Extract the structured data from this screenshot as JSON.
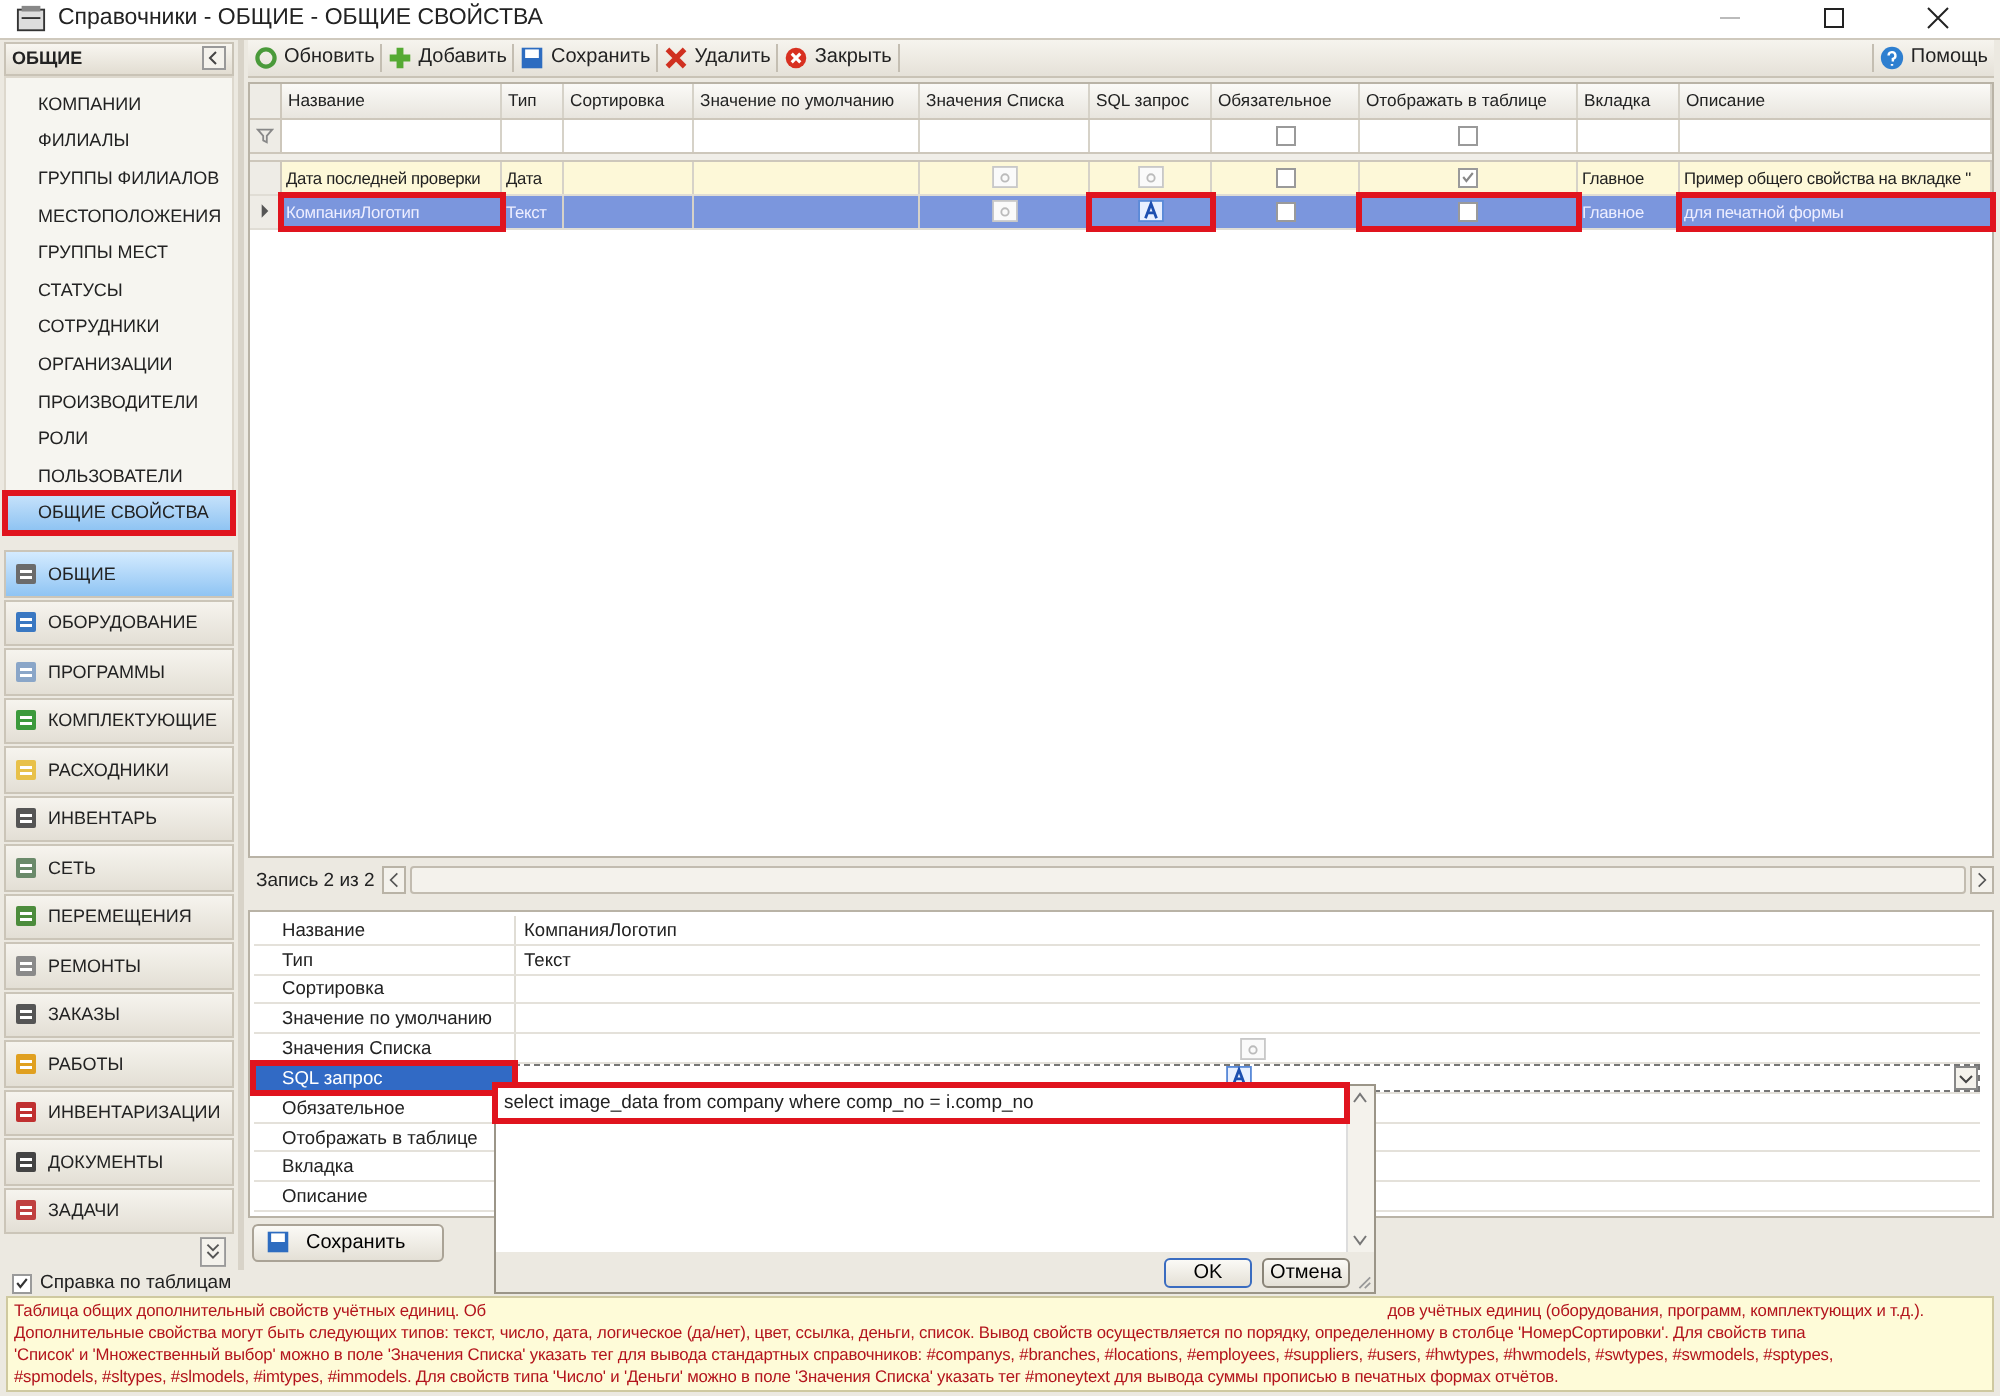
{
  "window": {
    "title": "Справочники - ОБЩИЕ - ОБЩИЕ СВОЙСТВА"
  },
  "sidebar": {
    "header": "ОБЩИЕ",
    "items": [
      {
        "label": "КОМПАНИИ",
        "selected": false,
        "highlighted": false
      },
      {
        "label": "ФИЛИАЛЫ",
        "selected": false,
        "highlighted": false
      },
      {
        "label": "ГРУППЫ ФИЛИАЛОВ",
        "selected": false,
        "highlighted": false
      },
      {
        "label": "МЕСТОПОЛОЖЕНИЯ",
        "selected": false,
        "highlighted": false
      },
      {
        "label": "ГРУППЫ МЕСТ",
        "selected": false,
        "highlighted": false
      },
      {
        "label": "СТАТУСЫ",
        "selected": false,
        "highlighted": false
      },
      {
        "label": "СОТРУДНИКИ",
        "selected": false,
        "highlighted": false
      },
      {
        "label": "ОРГАНИЗАЦИИ",
        "selected": false,
        "highlighted": false
      },
      {
        "label": "ПРОИЗВОДИТЕЛИ",
        "selected": false,
        "highlighted": false
      },
      {
        "label": "РОЛИ",
        "selected": false,
        "highlighted": false
      },
      {
        "label": "ПОЛЬЗОВАТЕЛИ",
        "selected": false,
        "highlighted": false
      },
      {
        "label": "ОБЩИЕ СВОЙСТВА",
        "selected": true,
        "highlighted": true
      }
    ],
    "sections": [
      {
        "label": "ОБЩИЕ",
        "selected": true
      },
      {
        "label": "ОБОРУДОВАНИЕ",
        "selected": false
      },
      {
        "label": "ПРОГРАММЫ",
        "selected": false
      },
      {
        "label": "КОМПЛЕКТУЮЩИЕ",
        "selected": false
      },
      {
        "label": "РАСХОДНИКИ",
        "selected": false
      },
      {
        "label": "ИНВЕНТАРЬ",
        "selected": false
      },
      {
        "label": "СЕТЬ",
        "selected": false
      },
      {
        "label": "ПЕРЕМЕЩЕНИЯ",
        "selected": false
      },
      {
        "label": "РЕМОНТЫ",
        "selected": false
      },
      {
        "label": "ЗАКАЗЫ",
        "selected": false
      },
      {
        "label": "РАБОТЫ",
        "selected": false
      },
      {
        "label": "ИНВЕНТАРИЗАЦИИ",
        "selected": false
      },
      {
        "label": "ДОКУМЕНТЫ",
        "selected": false
      },
      {
        "label": "ЗАДАЧИ",
        "selected": false
      }
    ]
  },
  "toolbar": {
    "buttons": [
      {
        "label": "Обновить",
        "kind": "refresh"
      },
      {
        "label": "Добавить",
        "kind": "add"
      },
      {
        "label": "Сохранить",
        "kind": "save"
      },
      {
        "label": "Удалить",
        "kind": "delete"
      },
      {
        "label": "Закрыть",
        "kind": "close"
      }
    ],
    "help": "Помощь"
  },
  "grid": {
    "columns": [
      {
        "label": "Название",
        "kind": "text"
      },
      {
        "label": "Тип",
        "kind": "text"
      },
      {
        "label": "Сортировка",
        "kind": "text"
      },
      {
        "label": "Значение по умолчанию",
        "kind": "text"
      },
      {
        "label": "Значения Списка",
        "kind": "icon"
      },
      {
        "label": "SQL запрос",
        "kind": "icon"
      },
      {
        "label": "Обязательное",
        "kind": "check",
        "filter_checked": false
      },
      {
        "label": "Отображать в таблице",
        "kind": "check",
        "filter_checked": false
      },
      {
        "label": "Вкладка",
        "kind": "text"
      },
      {
        "label": "Описание",
        "kind": "text"
      }
    ],
    "rows": [
      {
        "selected": false,
        "cells": [
          {
            "value": "Дата последней проверки",
            "highlighted": false
          },
          {
            "value": "Дата",
            "highlighted": false
          },
          {
            "highlighted": false
          },
          {
            "highlighted": false
          },
          {
            "filled": false,
            "highlighted": false
          },
          {
            "filled": false,
            "highlighted": false
          },
          {
            "checked": false,
            "highlighted": false
          },
          {
            "checked": true,
            "highlighted": false
          },
          {
            "value": "Главное",
            "highlighted": false
          },
          {
            "value": "Пример общего свойства на вкладке \"",
            "highlighted": false
          }
        ]
      },
      {
        "selected": true,
        "cells": [
          {
            "value": "КомпанияЛоготип",
            "highlighted": true
          },
          {
            "value": "Текст",
            "highlighted": false
          },
          {
            "highlighted": false
          },
          {
            "highlighted": false
          },
          {
            "filled": false,
            "highlighted": false
          },
          {
            "filled": true,
            "highlighted": true
          },
          {
            "checked": false,
            "highlighted": false
          },
          {
            "checked": false,
            "highlighted": true
          },
          {
            "value": "Главное",
            "highlighted": false
          },
          {
            "value": "для печатной формы",
            "highlighted": true
          }
        ]
      }
    ]
  },
  "record_nav": {
    "label": "Запись 2 из 2"
  },
  "properties": [
    {
      "label": "Название",
      "kind": "text",
      "value": "КомпанияЛоготип",
      "selected": false,
      "highlighted": false
    },
    {
      "label": "Тип",
      "kind": "text",
      "value": "Текст",
      "selected": false,
      "highlighted": false
    },
    {
      "label": "Сортировка",
      "kind": "text",
      "selected": false,
      "highlighted": false
    },
    {
      "label": "Значение по умолчанию",
      "kind": "text",
      "selected": false,
      "highlighted": false
    },
    {
      "label": "Значения Списка",
      "kind": "icon",
      "filled": false,
      "selected": false,
      "highlighted": false
    },
    {
      "label": "SQL запрос",
      "kind": "icon",
      "filled": true,
      "selected": true,
      "highlighted": true
    },
    {
      "label": "Обязательное",
      "kind": "text",
      "selected": false,
      "highlighted": false
    },
    {
      "label": "Отображать в таблице",
      "kind": "text",
      "selected": false,
      "highlighted": false
    },
    {
      "label": "Вкладка",
      "kind": "text",
      "selected": false,
      "highlighted": false
    },
    {
      "label": "Описание",
      "kind": "text",
      "selected": false,
      "highlighted": false
    }
  ],
  "save_button": "Сохранить",
  "sql_popup": {
    "text": "select image_data from company where comp_no = i.comp_no",
    "highlighted": true,
    "buttons": [
      "OK",
      "Отмена"
    ]
  },
  "help": {
    "label": "Справка по таблицам",
    "checked": true,
    "first_line_start": "Таблица общих дополнительный свойств учётных единиц. Об",
    "first_line_end": "дов учётных единиц (оборудования, программ, комплектующих и т.д.).",
    "lines": [
      "Дополнительные свойства могут быть следующих типов: текст, число, дата, логическое (да/нет), цвет, ссылка, деньги, список. Вывод свойств осуществляется по порядку, определенному в столбце 'НомерСортировки'. Для свойств типа",
      "'Список' и 'Множественный выбор' можно в поле 'Значения Списка' указать тег для вывода стандартных справочников: #companys, #branches, #locations, #employees, #suppliers, #users, #hwtypes, #hwmodels, #swtypes, #swmodels, #sptypes,",
      "#spmodels, #sltypes, #slmodels, #imtypes, #immodels. Для свойств типа 'Число' и 'Деньги' можно в поле 'Значения Списка' указать тег #moneytext для вывода суммы прописью в печатных формах отчётов."
    ]
  }
}
